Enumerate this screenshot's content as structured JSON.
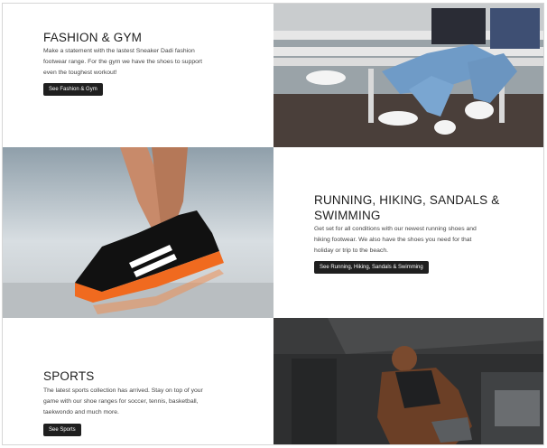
{
  "sections": [
    {
      "title": "FASHION & GYM",
      "description_lines": [
        "Make a statement with the lastest Sneaker Dadi fashion",
        "footwear range. For the gym we have the shoes to support",
        "even the toughest workout!"
      ],
      "button_label": "See Fashion & Gym"
    },
    {
      "title_lines": [
        "RUNNING, HIKING, SANDALS &",
        "SWIMMING"
      ],
      "description_lines": [
        "Get set for all conditions with our newest running shoes and",
        "hiking footwear. We also have the shoes you need for that",
        "holiday or trip to the beach."
      ],
      "button_label": "See Running, Hiking, Sandals & Swimming"
    },
    {
      "title": "SPORTS",
      "description_lines": [
        "The latest sports collection has arrived. Stay on top of your",
        "game with our shoe ranges for soccer, tennis, basketball,",
        "taekwondo and much more."
      ],
      "button_label": "See Sports"
    }
  ],
  "photos": {
    "fashion": "sneakers-on-bench-photo",
    "running": "running-shoe-photo",
    "sports": "athlete-crouching-photo"
  },
  "colors": {
    "button_bg": "#1f1f1f",
    "shoe_accent": "#f06a1f"
  }
}
